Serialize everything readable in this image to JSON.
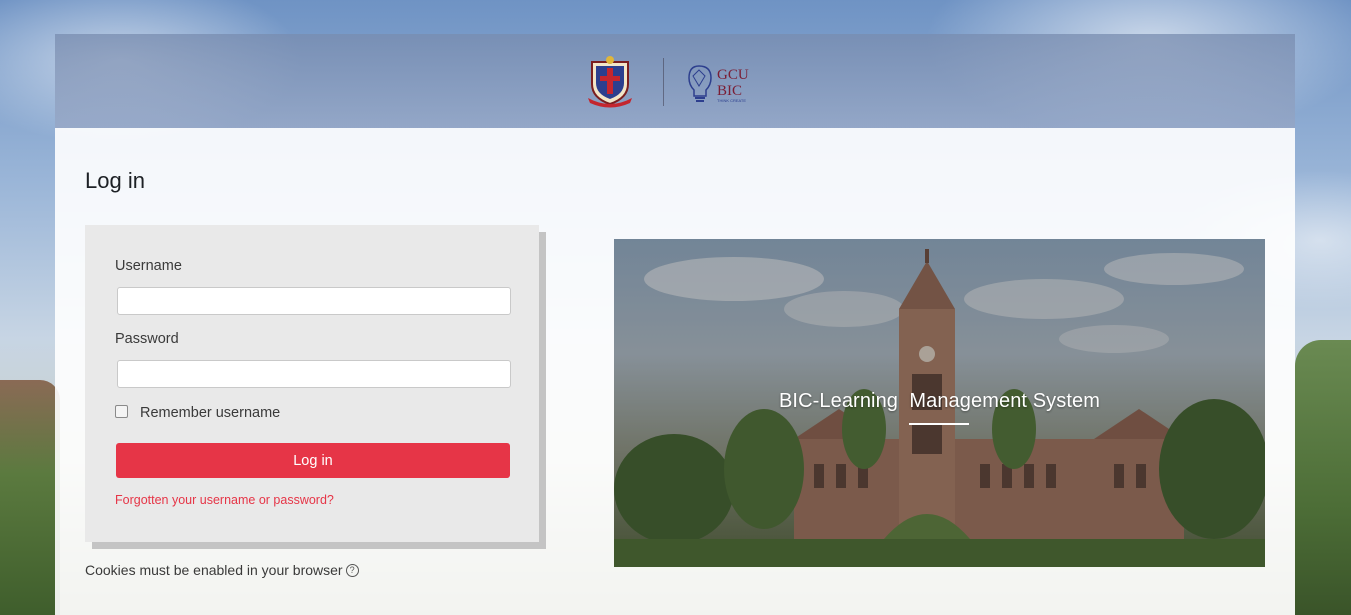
{
  "header": {
    "left_logo_icon": "university-crest-icon",
    "right_logo_icon": "gcu-bic-lightbulb-icon",
    "right_logo_text_line1": "GCU",
    "right_logo_text_line2": "BIC",
    "right_logo_tagline": "THINK CREATE"
  },
  "login": {
    "page_title": "Log in",
    "username_label": "Username",
    "username_value": "",
    "password_label": "Password",
    "password_value": "",
    "remember_label": "Remember username",
    "remember_checked": false,
    "submit_label": "Log in",
    "forgot_link": "Forgotten your username or password?",
    "cookies_notice": "Cookies must be enabled in your browser",
    "help_icon": "question-circle-icon"
  },
  "hero": {
    "title": "BIC-Learning  Management System"
  },
  "colors": {
    "accent": "#e63547",
    "text": "#3a3a3a",
    "login_box_bg": "#e9e9e9"
  }
}
